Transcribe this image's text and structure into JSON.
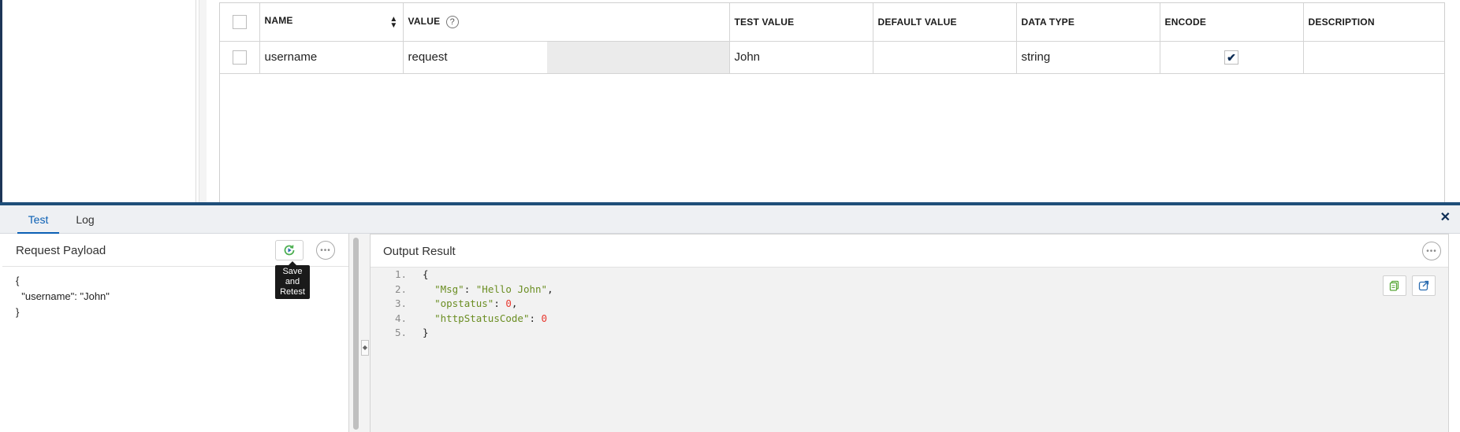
{
  "table": {
    "headers": {
      "name": "NAME",
      "value": "VALUE",
      "help": "?",
      "test_value": "TEST VALUE",
      "default_value": "DEFAULT VALUE",
      "data_type": "DATA TYPE",
      "encode": "ENCODE",
      "description": "DESCRIPTION"
    },
    "rows": [
      {
        "name": "username",
        "value": "request",
        "test_value": "John",
        "default_value": "",
        "data_type": "string",
        "encode": true,
        "description": ""
      }
    ]
  },
  "tabs": [
    {
      "label": "Test",
      "active": true
    },
    {
      "label": "Log",
      "active": false
    }
  ],
  "request": {
    "title": "Request Payload",
    "body": "{\n  \"username\": \"John\"\n}",
    "tooltip": "Save and Retest"
  },
  "output": {
    "title": "Output Result",
    "lines": [
      {
        "num": "1."
      },
      {
        "num": "2.",
        "key": "\"Msg\"",
        "value": "\"Hello John\""
      },
      {
        "num": "3.",
        "key": "\"opstatus\"",
        "value": "0"
      },
      {
        "num": "4.",
        "key": "\"httpStatusCode\"",
        "value": "0"
      },
      {
        "num": "5."
      }
    ]
  },
  "icons": {
    "retest": "retest-icon",
    "more": "more-options-icon",
    "copy": "copy-icon",
    "popout": "popout-icon",
    "close": "close-icon"
  },
  "colors": {
    "accent": "#0a5fb4",
    "panel_line": "#1f4e79",
    "json_string": "#6b8e23",
    "json_number": "#e8382f",
    "retest_green": "#4caf50"
  }
}
